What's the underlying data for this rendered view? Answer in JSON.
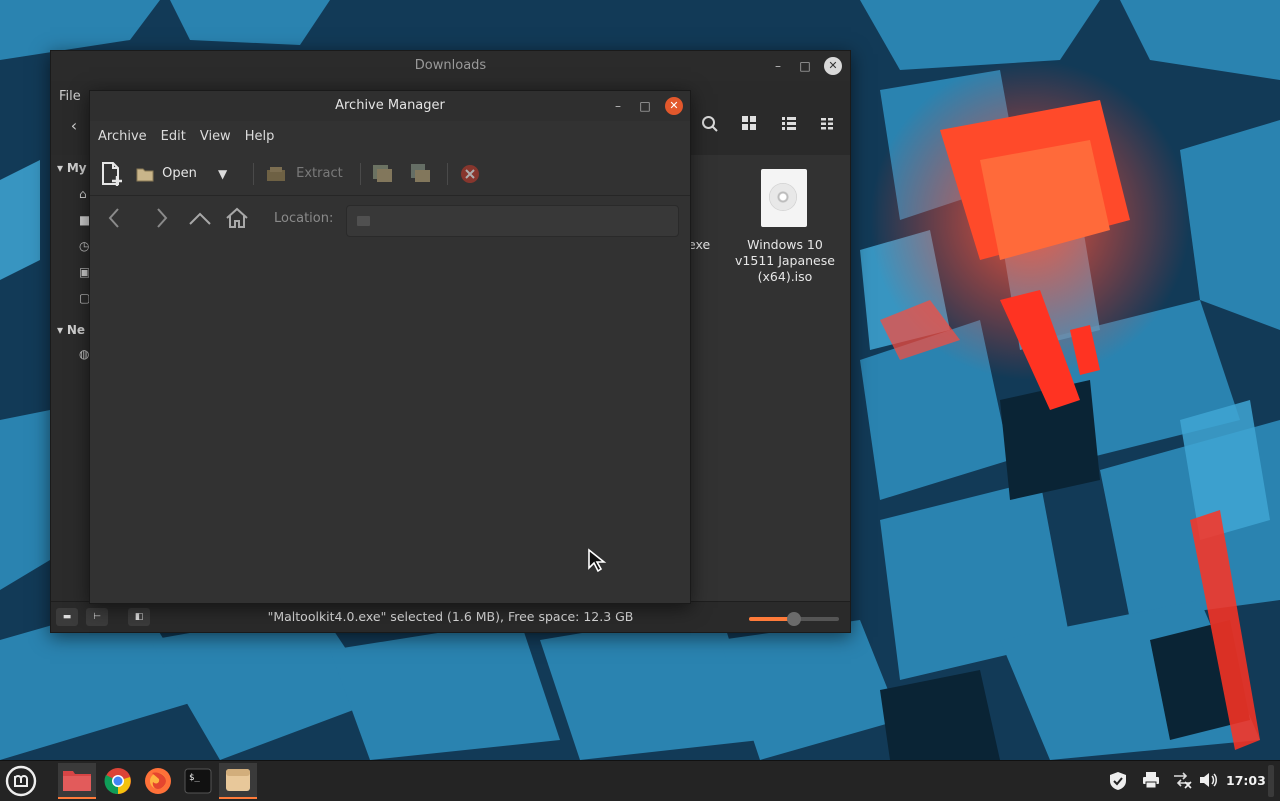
{
  "desktop": {
    "wallpaper": "blue-3d-cubes-red-glow"
  },
  "file_manager": {
    "title": "Downloads",
    "menu": [
      "File"
    ],
    "sidebar_partial": [
      "My",
      "Ne"
    ],
    "files": [
      {
        "name_partial": "exe"
      },
      {
        "name": "Windows 10 v1511 Japanese (x64).iso",
        "icon": "disc-image-icon"
      }
    ],
    "status": "\"Maltoolkit4.0.exe\" selected (1.6 MB), Free space: 12.3 GB",
    "zoom_level": 0.5,
    "window_controls": {
      "minimize": "–",
      "maximize": "□",
      "close": "✕"
    }
  },
  "archive_manager": {
    "title": "Archive Manager",
    "menu": [
      "Archive",
      "Edit",
      "View",
      "Help"
    ],
    "toolbar": {
      "open_label": "Open",
      "extract_label": "Extract"
    },
    "location_label": "Location:",
    "location_value": "",
    "window_controls": {
      "minimize": "–",
      "maximize": "□",
      "close": "✕"
    }
  },
  "taskbar": {
    "clock": "17:03",
    "apps": [
      "menu",
      "files",
      "chrome",
      "firefox",
      "terminal",
      "archive-manager"
    ],
    "active_app": "archive-manager"
  },
  "colors": {
    "accent": "#ff7b3a",
    "window_bg": "#323232",
    "taskbar_bg": "#242424"
  }
}
